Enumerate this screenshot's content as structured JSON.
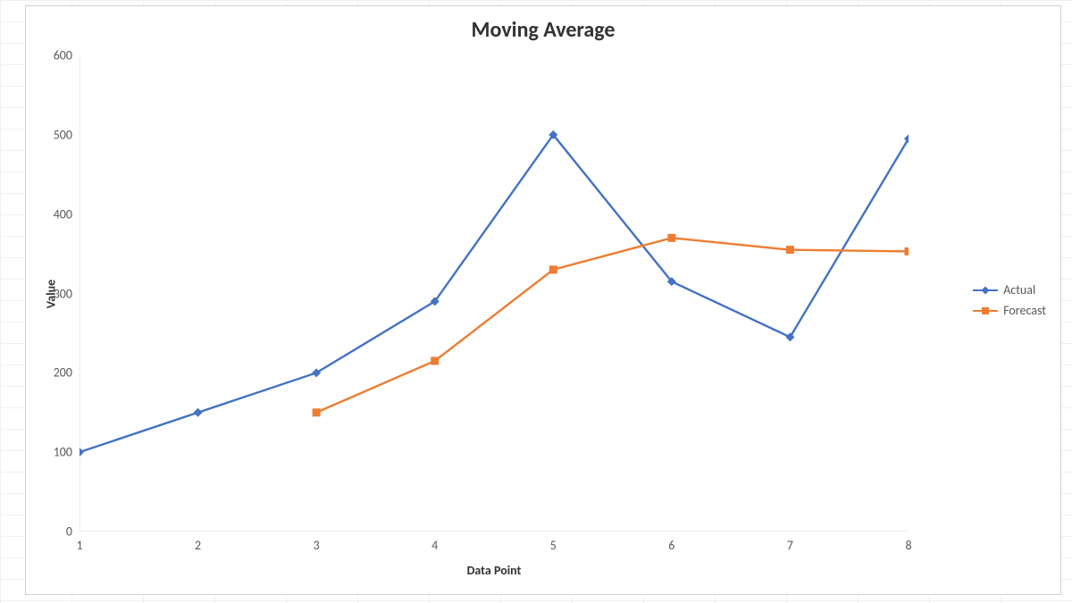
{
  "chart_data": {
    "type": "line",
    "title": "Moving Average",
    "xlabel": "Data Point",
    "ylabel": "Value",
    "x": [
      1,
      2,
      3,
      4,
      5,
      6,
      7,
      8
    ],
    "series": [
      {
        "name": "Actual",
        "values": [
          100,
          150,
          200,
          290,
          500,
          315,
          245,
          495
        ],
        "color": "#4472C4",
        "marker": "diamond"
      },
      {
        "name": "Forecast",
        "values": [
          null,
          null,
          150,
          215,
          330,
          370,
          355,
          353
        ],
        "color": "#ED7D31",
        "marker": "square"
      }
    ],
    "ylim": [
      0,
      600
    ],
    "ytick_step": 100
  },
  "y_ticks": [
    "0",
    "100",
    "200",
    "300",
    "400",
    "500",
    "600"
  ],
  "x_ticks": [
    "1",
    "2",
    "3",
    "4",
    "5",
    "6",
    "7",
    "8"
  ]
}
